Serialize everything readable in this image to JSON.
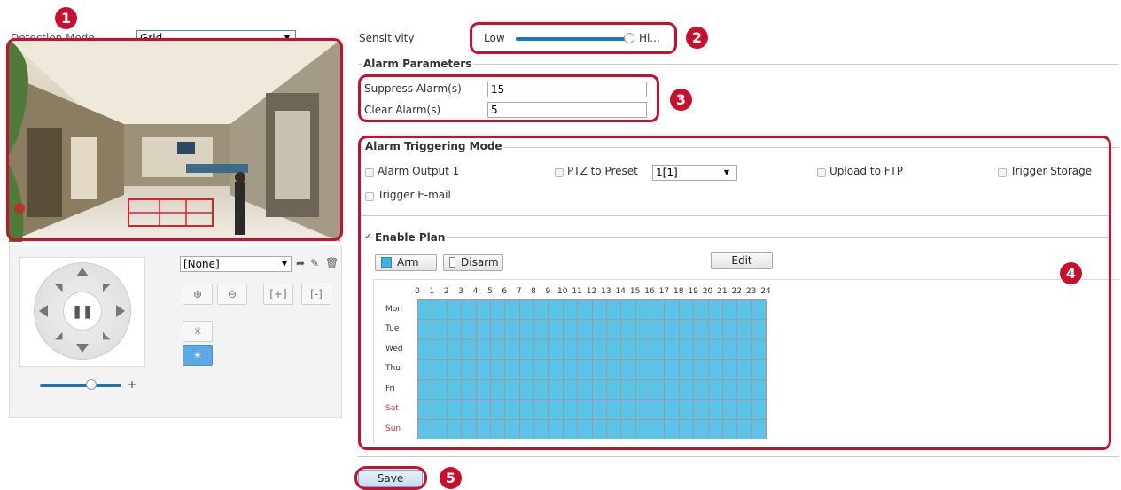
{
  "detection": {
    "mode_label": "Detection Mode",
    "mode_value": "Grid"
  },
  "sensitivity": {
    "label": "Sensitivity",
    "low": "Low",
    "high": "Hi...",
    "level": 0.98
  },
  "alarm_params": {
    "title": "Alarm Parameters",
    "suppress_label": "Suppress Alarm(s)",
    "suppress_value": "15",
    "clear_label": "Clear Alarm(s)",
    "clear_value": "5"
  },
  "triggering": {
    "title": "Alarm Triggering Mode",
    "alarm_output": "Alarm Output 1",
    "ptz_preset": "PTZ to Preset",
    "ptz_value": "1[1]",
    "upload_ftp": "Upload to FTP",
    "trigger_storage": "Trigger Storage",
    "trigger_email": "Trigger E-mail"
  },
  "plan": {
    "title": "Enable Plan",
    "arm": "Arm",
    "disarm": "Disarm",
    "edit": "Edit",
    "hours": [
      "0",
      "1",
      "2",
      "3",
      "4",
      "5",
      "6",
      "7",
      "8",
      "9",
      "10",
      "11",
      "12",
      "13",
      "14",
      "15",
      "16",
      "17",
      "18",
      "19",
      "20",
      "21",
      "22",
      "23",
      "24"
    ],
    "days": [
      "Mon",
      "Tue",
      "Wed",
      "Thu",
      "Fri",
      "Sat",
      "Sun"
    ],
    "armed_color": "#5bc4e6"
  },
  "ptz": {
    "preset": "[None]",
    "zoom_level": 0.5,
    "minus": "-",
    "plus": "+"
  },
  "save": "Save",
  "markers": [
    "1",
    "2",
    "3",
    "4",
    "5"
  ],
  "colors": {
    "accent": "#c8102e",
    "weekend": "#e0302a",
    "slider": "#1e73be"
  }
}
